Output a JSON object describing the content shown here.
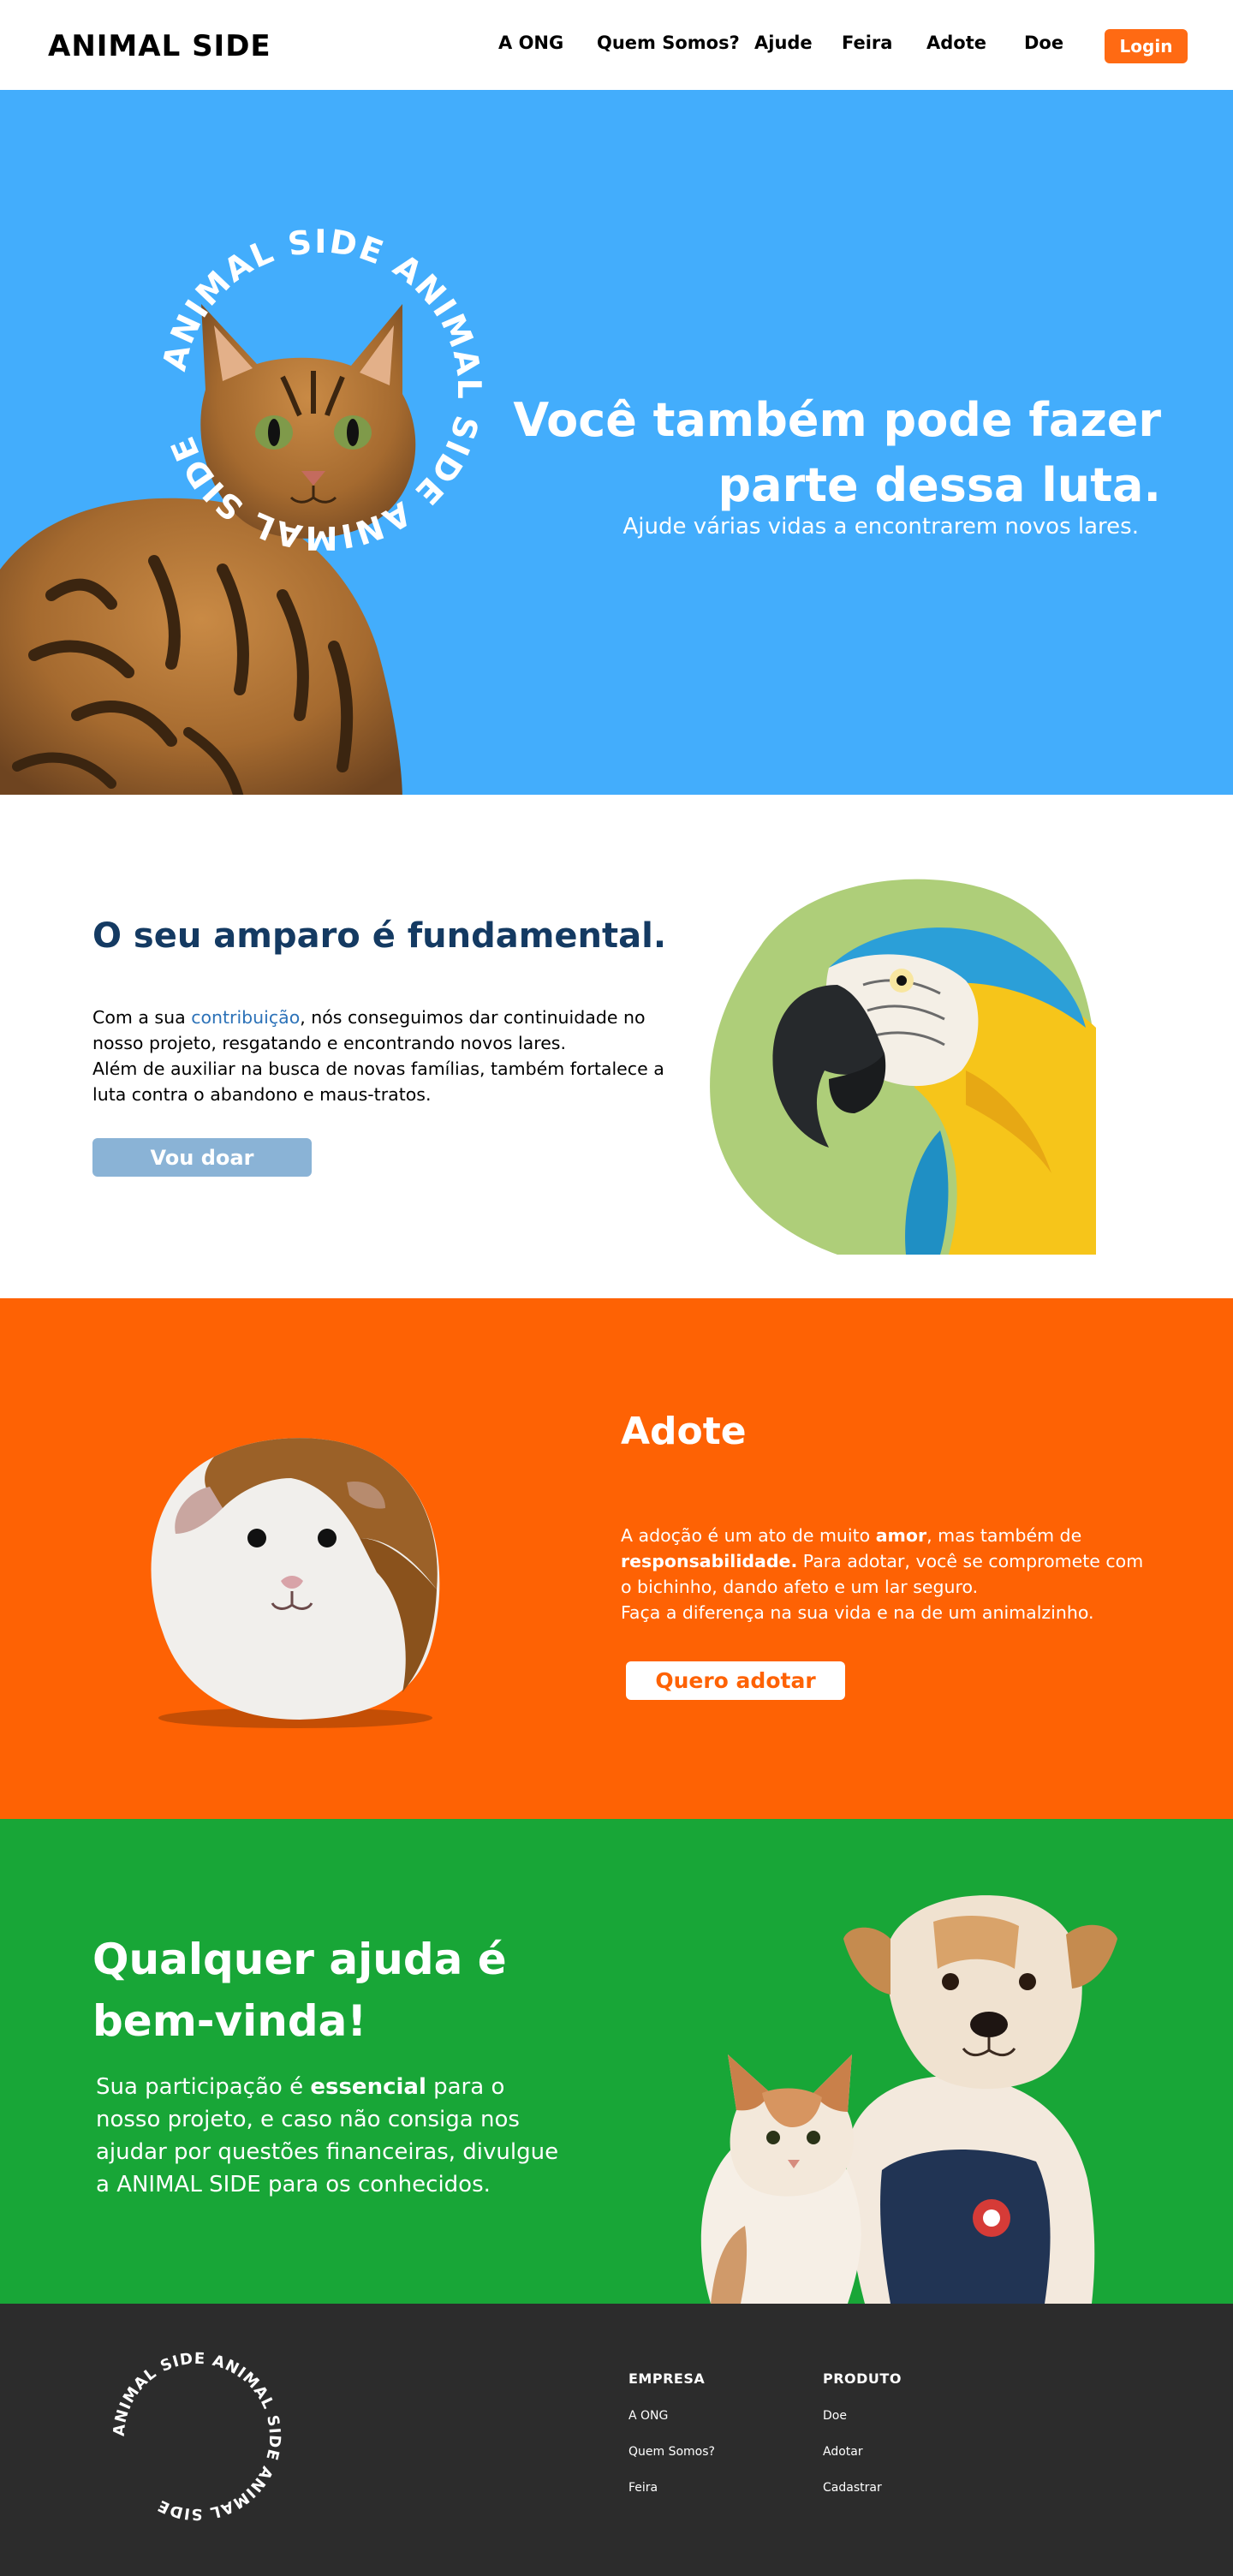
{
  "nav": {
    "brand": "ANIMAL SIDE",
    "links": [
      "A ONG",
      "Quem Somos?",
      "Ajude",
      "Feira",
      "Adote",
      "Doe"
    ],
    "login_label": "Login"
  },
  "hero": {
    "ring_text": "ANIMAL SIDE ANIMAL SIDE ANIMAL SIDE",
    "title_line1": "Você também pode fazer",
    "title_line2": "parte dessa luta.",
    "subtitle": "Ajude várias vidas a encontrarem novos lares."
  },
  "amparo": {
    "title": "O seu amparo é fundamental.",
    "text_pre": "Com a sua ",
    "text_link": "contribuição",
    "text_post": ", nós conseguimos dar continuidade no nosso projeto, resgatando e encontrando novos lares.",
    "text_line2": "Além de auxiliar na busca de novas famílias, também fortalece a luta contra o abandono e maus-tratos.",
    "button_label": "Vou doar"
  },
  "adote": {
    "title": "Adote",
    "text_a": "A adoção é um ato de muito ",
    "text_b": "amor",
    "text_c": ", mas também de ",
    "text_d": "responsabilidade.",
    "text_e": " Para adotar, você se compromete com o bichinho, dando afeto e um lar seguro.",
    "text_line2": "Faça a diferença na sua vida e na de um animalzinho.",
    "button_label": "Quero adotar"
  },
  "ajuda": {
    "title_line1": "Qualquer ajuda é",
    "title_line2": "bem-vinda!",
    "text_a": "Sua participação é ",
    "text_b": "essencial",
    "text_c": " para o nosso projeto, e caso não consiga nos ajudar por questões financeiras, divulgue a ANIMAL SIDE para os conhecidos."
  },
  "footer": {
    "ring_text": "ANIMAL SIDE ANIMAL SIDE ANIMAL SIDE",
    "empresa_head": "EMPRESA",
    "empresa_links": [
      "A ONG",
      "Quem Somos?",
      "Feira"
    ],
    "produto_head": "PRODUTO",
    "produto_links": [
      "Doe",
      "Adotar",
      "Cadastrar"
    ]
  },
  "colors": {
    "hero_bg": "#43adfc",
    "accent_orange": "#fe6204",
    "green_bg": "#18a637",
    "footer_bg": "#2c2c2c",
    "navy_title": "#143a62"
  },
  "icons": [
    "cat-image",
    "parrot-image",
    "guinea-pig-image",
    "dog-and-cat-image",
    "brand-ring-logo"
  ]
}
